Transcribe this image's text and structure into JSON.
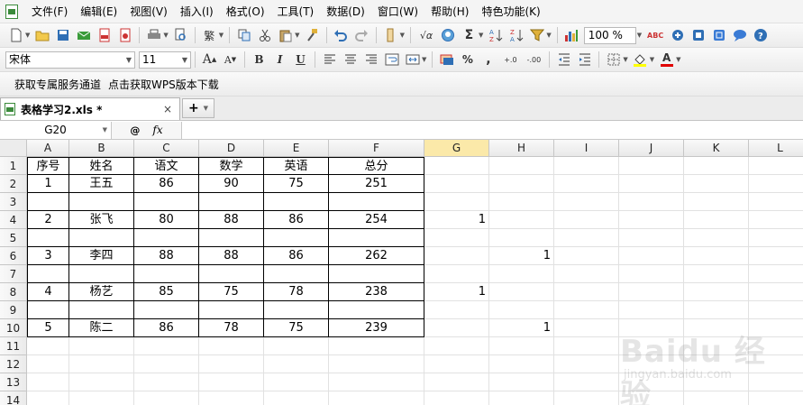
{
  "menu": [
    "文件(F)",
    "编辑(E)",
    "视图(V)",
    "插入(I)",
    "格式(O)",
    "工具(T)",
    "数据(D)",
    "窗口(W)",
    "帮助(H)",
    "特色功能(K)"
  ],
  "toolbar": {
    "traditional_label": "繁",
    "sum_label": "Σ",
    "zoom_value": "100 %",
    "sqrt_label": "√α",
    "spell_label": "ABC"
  },
  "format": {
    "font_name": "宋体",
    "font_size": "11",
    "grow_label": "A",
    "shrink_label": "A",
    "bold_label": "B",
    "italic_label": "I",
    "underline_label": "U",
    "percent_label": "%",
    "comma_label": ",",
    "inc_decimal_label": "+.0",
    "dec_decimal_label": "-.00",
    "font_color_label": "A"
  },
  "links": {
    "service_channel": "获取专属服务通道",
    "wps_download": "点击获取WPS版本下载"
  },
  "document": {
    "tab_title": "表格学习2.xls *",
    "close_label": "×",
    "new_tab_label": "+"
  },
  "formula_bar": {
    "cell_ref": "G20",
    "fx_label": "fx",
    "search_label": "@"
  },
  "columns": [
    "A",
    "B",
    "C",
    "D",
    "E",
    "F",
    "G",
    "H",
    "I",
    "J",
    "K",
    "L"
  ],
  "rows": [
    "1",
    "2",
    "3",
    "4",
    "5",
    "6",
    "7",
    "8",
    "9",
    "10",
    "11",
    "12",
    "13",
    "14"
  ],
  "table": {
    "header": [
      "序号",
      "姓名",
      "语文",
      "数学",
      "英语",
      "总分"
    ],
    "rows": [
      [
        "1",
        "王五",
        "86",
        "90",
        "75",
        "251"
      ],
      [
        "",
        "",
        "",
        "",
        "",
        ""
      ],
      [
        "2",
        "张飞",
        "80",
        "88",
        "86",
        "254"
      ],
      [
        "",
        "",
        "",
        "",
        "",
        ""
      ],
      [
        "3",
        "李四",
        "88",
        "88",
        "86",
        "262"
      ],
      [
        "",
        "",
        "",
        "",
        "",
        ""
      ],
      [
        "4",
        "杨艺",
        "85",
        "75",
        "78",
        "238"
      ],
      [
        "",
        "",
        "",
        "",
        "",
        ""
      ],
      [
        "5",
        "陈二",
        "86",
        "78",
        "75",
        "239"
      ]
    ]
  },
  "extra_cells": [
    {
      "ref": "G4",
      "value": "1"
    },
    {
      "ref": "H6",
      "value": "1"
    },
    {
      "ref": "G8",
      "value": "1"
    },
    {
      "ref": "H10",
      "value": "1"
    }
  ],
  "watermark": {
    "text": "Baidu 经验",
    "sub": "jingyan.baidu.com"
  }
}
